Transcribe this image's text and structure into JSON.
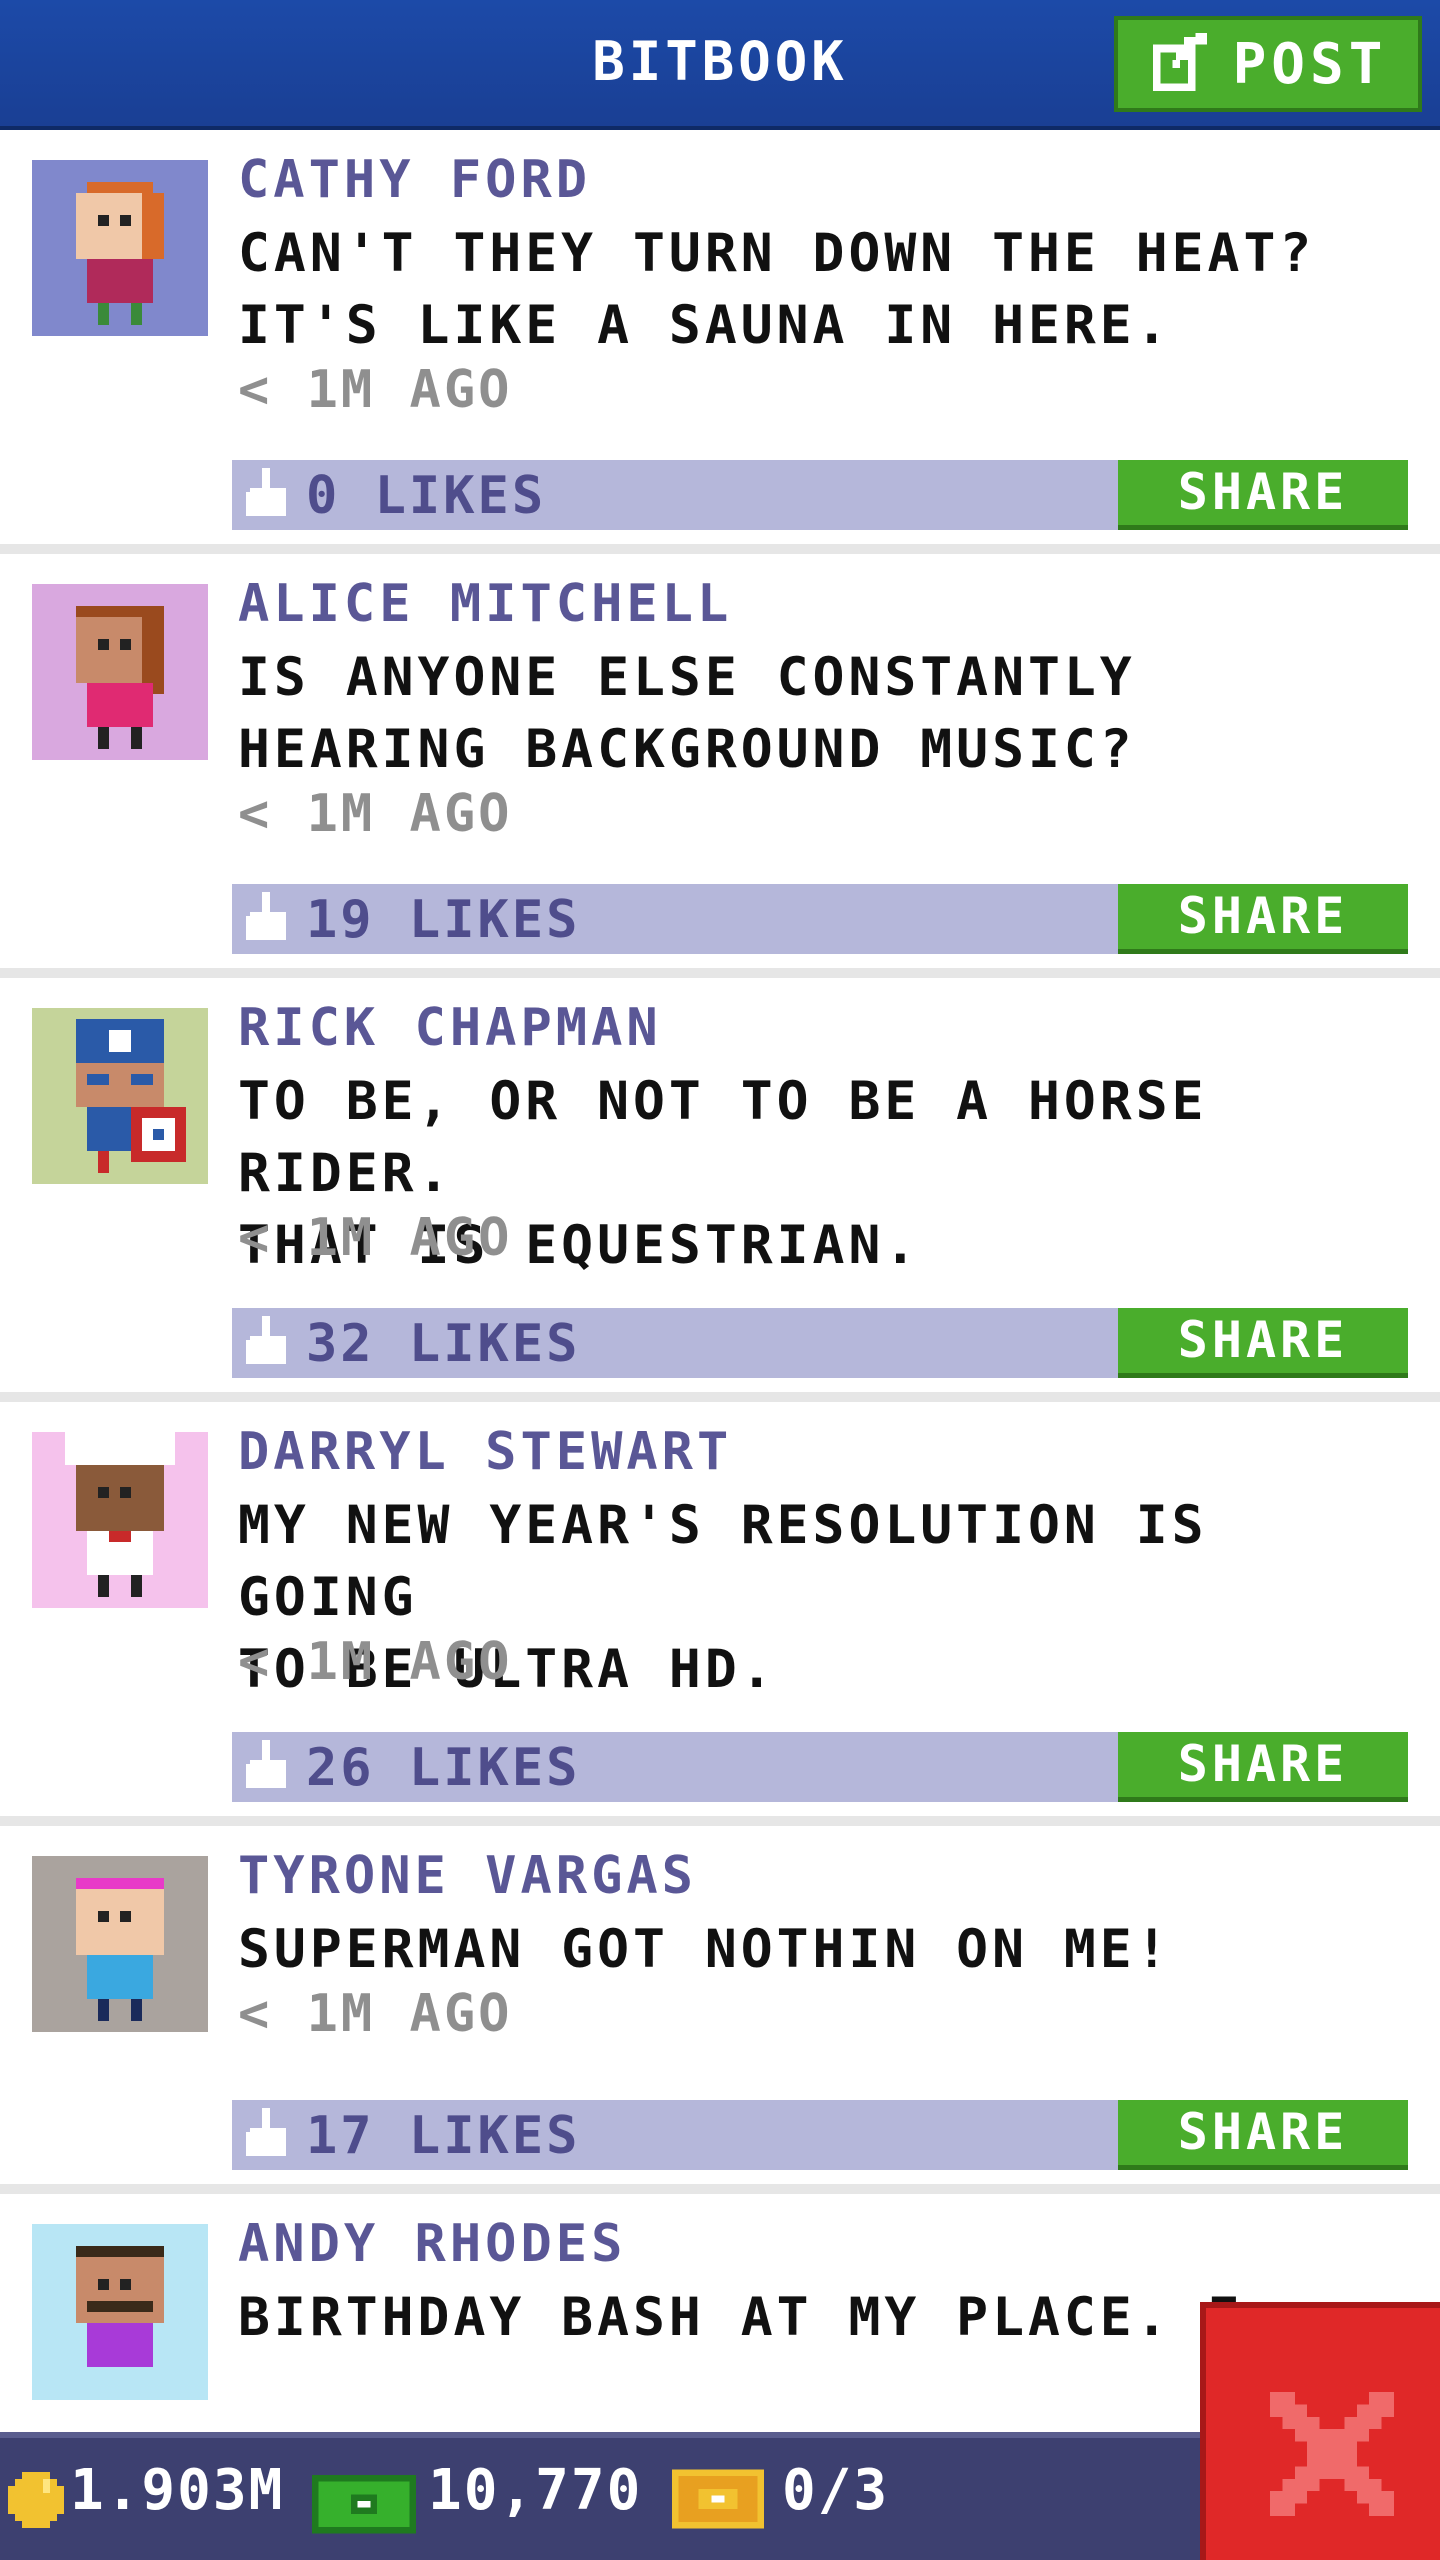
{
  "header": {
    "title": "BITBOOK",
    "post_label": "POST"
  },
  "posts": [
    {
      "author": "CATHY FORD",
      "message_lines": [
        "CAN'T THEY TURN DOWN THE HEAT?",
        "IT'S LIKE A SAUNA IN HERE."
      ],
      "time": "< 1M AGO",
      "likes": "0 LIKES",
      "share_label": "SHARE",
      "avatar_bg": "#8088cc"
    },
    {
      "author": "ALICE MITCHELL",
      "message_lines": [
        "IS ANYONE ELSE CONSTANTLY",
        "HEARING BACKGROUND MUSIC?"
      ],
      "time": "< 1M AGO",
      "likes": "19 LIKES",
      "share_label": "SHARE",
      "avatar_bg": "#d9a8df"
    },
    {
      "author": "RICK CHAPMAN",
      "message_lines": [
        "TO BE, OR NOT TO BE A HORSE RIDER.",
        "THAT IS EQUESTRIAN."
      ],
      "time": "< 1M AGO",
      "likes": "32 LIKES",
      "share_label": "SHARE",
      "avatar_bg": "#c5d49a"
    },
    {
      "author": "DARRYL STEWART",
      "message_lines": [
        "MY NEW YEAR'S RESOLUTION IS GOING",
        "TO BE ULTRA HD."
      ],
      "time": "< 1M AGO",
      "likes": "26 LIKES",
      "share_label": "SHARE",
      "avatar_bg": "#f5c2ec"
    },
    {
      "author": "TYRONE VARGAS",
      "message_lines": [
        "SUPERMAN GOT NOTHIN ON ME!"
      ],
      "time": "< 1M AGO",
      "likes": "17 LIKES",
      "share_label": "SHARE",
      "avatar_bg": "#aaa39e"
    },
    {
      "author": "ANDY RHODES",
      "message_lines": [
        "BIRTHDAY BASH AT MY PLACE. E"
      ],
      "avatar_bg": "#b8e6f5"
    }
  ],
  "bottombar": {
    "coins": "1.903M",
    "bux": "10,770",
    "tickets": "0/3"
  },
  "colors": {
    "header": "#1c4aa8",
    "green": "#4aad2c",
    "likebar": "#b5b7da",
    "author": "#5a5796",
    "close": "#e02828"
  },
  "icons": {
    "post": "edit-icon",
    "like": "thumbs-up-icon",
    "coin": "coin-icon",
    "bux": "bux-icon",
    "ticket": "ticket-icon",
    "close": "close-icon"
  }
}
